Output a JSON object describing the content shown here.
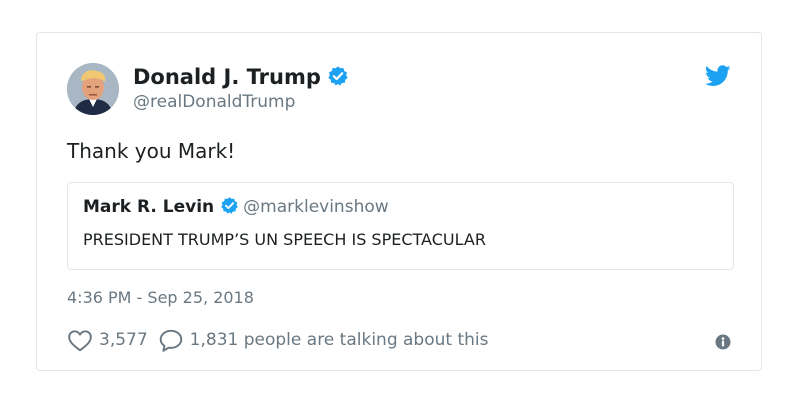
{
  "tweet": {
    "author": {
      "name": "Donald J. Trump",
      "handle": "@realDonaldTrump",
      "verified": true
    },
    "text": "Thank you Mark!",
    "timestamp": "4:36 PM - Sep 25, 2018",
    "likes": "3,577",
    "talking": "1,831 people are talking about this"
  },
  "quoted_tweet": {
    "name": "Mark R. Levin",
    "handle": "@marklevinshow",
    "verified": true,
    "text": "PRESIDENT TRUMP’S UN SPEECH IS SPECTACULAR"
  },
  "icons": {
    "brand": "twitter-bird-icon",
    "verified": "verified-badge-icon",
    "like": "heart-icon",
    "reply": "speech-bubble-icon",
    "info": "info-icon"
  },
  "colors": {
    "brand_blue": "#1da1f2",
    "text": "#1c2022",
    "muted": "#697882",
    "border": "#e1e8ed"
  }
}
